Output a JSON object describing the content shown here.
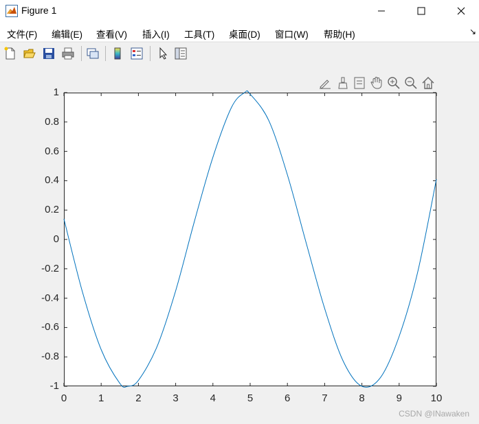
{
  "window": {
    "title": "Figure 1",
    "minimize_icon": "minimize-icon",
    "maximize_icon": "maximize-icon",
    "close_icon": "close-icon"
  },
  "menu": {
    "items": [
      "文件(F)",
      "编辑(E)",
      "查看(V)",
      "插入(I)",
      "工具(T)",
      "桌面(D)",
      "窗口(W)",
      "帮助(H)"
    ],
    "overflow": "↘"
  },
  "toolbar": {
    "icons": [
      "new-figure-icon",
      "open-file-icon",
      "save-icon",
      "print-icon",
      "link-plot-icon",
      "colorbar-icon",
      "legend-icon",
      "pointer-icon",
      "property-inspector-icon"
    ]
  },
  "axes_toolbar": {
    "icons": [
      "brush-edit-icon",
      "data-brush-icon",
      "data-tips-icon",
      "pan-hand-icon",
      "zoom-in-icon",
      "zoom-out-icon",
      "home-icon"
    ]
  },
  "colors": {
    "line": "#0072bd",
    "axes": "#262626",
    "background": "#f0f0f0"
  },
  "chart_data": {
    "type": "line",
    "function": "sin-like curve, period ≈ 6.28",
    "xlim": [
      0,
      10
    ],
    "ylim": [
      -1,
      1
    ],
    "x_ticks": [
      "0",
      "1",
      "2",
      "3",
      "4",
      "5",
      "6",
      "7",
      "8",
      "9",
      "10"
    ],
    "y_ticks": [
      "1",
      "0.8",
      "0.6",
      "0.4",
      "0.2",
      "0",
      "-0.2",
      "-0.4",
      "-0.6",
      "-0.8",
      "-1"
    ],
    "series": [
      {
        "x": [
          0,
          0.5,
          1,
          1.5,
          1.71,
          2,
          2.5,
          3,
          3.5,
          4,
          4.5,
          4.85,
          5,
          5.5,
          6,
          6.5,
          7,
          7.5,
          8,
          8.5,
          9,
          9.5,
          10
        ],
        "y": [
          0.14,
          -0.36,
          -0.75,
          -0.98,
          -1.0,
          -0.96,
          -0.73,
          -0.35,
          0.12,
          0.56,
          0.9,
          1.0,
          0.99,
          0.81,
          0.44,
          -0.02,
          -0.47,
          -0.83,
          -1.0,
          -0.94,
          -0.66,
          -0.22,
          0.41
        ]
      }
    ],
    "grid": false
  },
  "watermark": "CSDN @INawaken"
}
